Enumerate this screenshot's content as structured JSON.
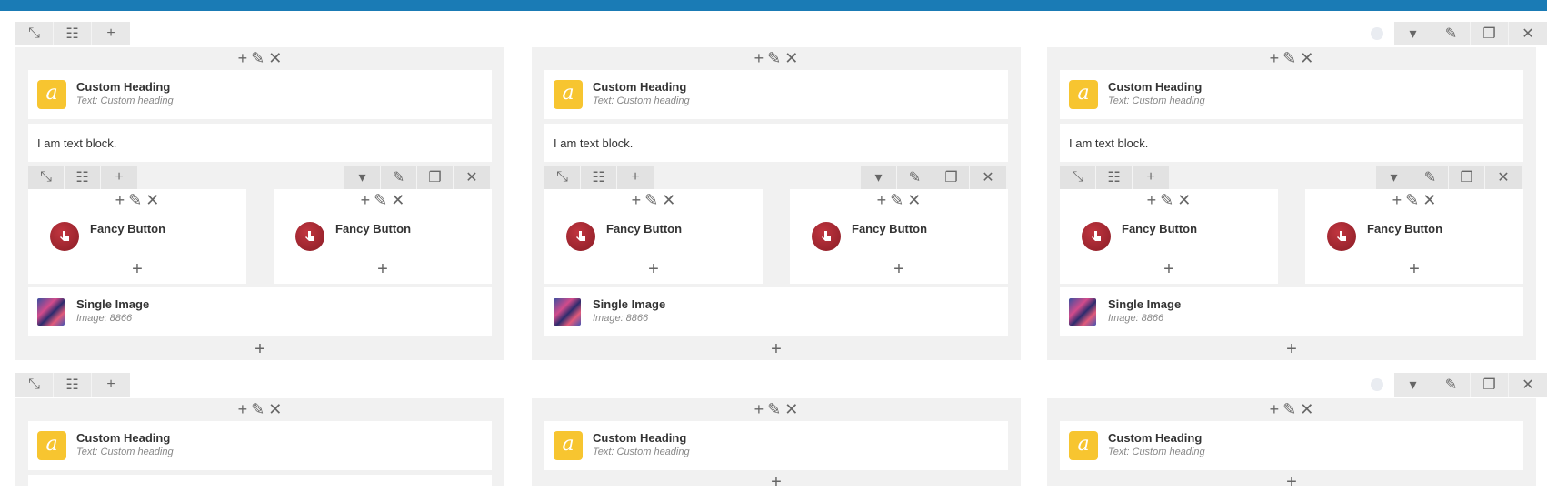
{
  "colors": {
    "topbar": "#1a7bb5",
    "heading_icon": "#f7c530",
    "fancy_icon": "#a32530"
  },
  "icons": {
    "expand": "expand-icon",
    "layout": "layout-icon",
    "add": "plus-icon",
    "toggle": "chevron-down-icon",
    "edit": "pencil-icon",
    "clone": "copy-icon",
    "delete": "close-icon"
  },
  "glyphs": {
    "expand": "⤡",
    "layout": "☷",
    "plus": "+",
    "caret": "▾",
    "pencil": "✎",
    "clone": "❐",
    "close": "✕"
  },
  "heading": {
    "title": "Custom Heading",
    "subtitle": "Text: Custom heading",
    "icon_letter": "a"
  },
  "text_block": {
    "text": "I am text block."
  },
  "fancy_button": {
    "title": "Fancy Button"
  },
  "single_image": {
    "title": "Single Image",
    "subtitle": "Image: 8866"
  }
}
